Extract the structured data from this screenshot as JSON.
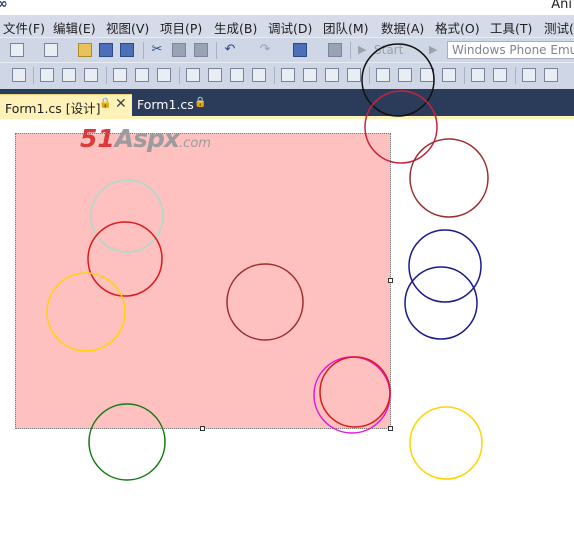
{
  "window": {
    "title": "Ani"
  },
  "menu": [
    {
      "label": "文件(F)"
    },
    {
      "label": "编辑(E)"
    },
    {
      "label": "视图(V)"
    },
    {
      "label": "项目(P)"
    },
    {
      "label": "生成(B)"
    },
    {
      "label": "调试(D)"
    },
    {
      "label": "团队(M)"
    },
    {
      "label": "数据(A)"
    },
    {
      "label": "格式(O)"
    },
    {
      "label": "工具(T)"
    },
    {
      "label": "测试(S"
    }
  ],
  "toolbar": {
    "start_label": "Start",
    "target_device": "Windows Phone Emu"
  },
  "tabs": [
    {
      "label": "Form1.cs [设计]",
      "active": true
    },
    {
      "label": "Form1.cs",
      "active": false
    }
  ],
  "watermark": {
    "part1": "51",
    "part2": "Aspx",
    "part3": ".com"
  },
  "colors": {
    "form_background": "#ffc0c0",
    "tab_active": "#fff2b8",
    "tabstrip": "#2b3b5a",
    "menubar": "#d6dbe9"
  },
  "icons": [
    "new-project-icon",
    "add-item-icon",
    "open-folder-icon",
    "save-icon",
    "save-all-icon",
    "cut-icon",
    "copy-icon",
    "paste-icon",
    "undo-icon",
    "redo-icon",
    "navigate-icon",
    "find-icon",
    "start-icon",
    "align-left-icon",
    "align-center-icon",
    "align-right-icon",
    "align-top-icon",
    "align-middle-icon",
    "align-bottom-icon",
    "make-same-width-icon",
    "make-same-height-icon",
    "make-same-size-icon",
    "size-to-grid-icon",
    "horizontal-spacing-icon",
    "vertical-spacing-icon",
    "center-horizontally-icon",
    "center-vertically-icon",
    "bring-to-front-icon",
    "send-to-back-icon"
  ]
}
